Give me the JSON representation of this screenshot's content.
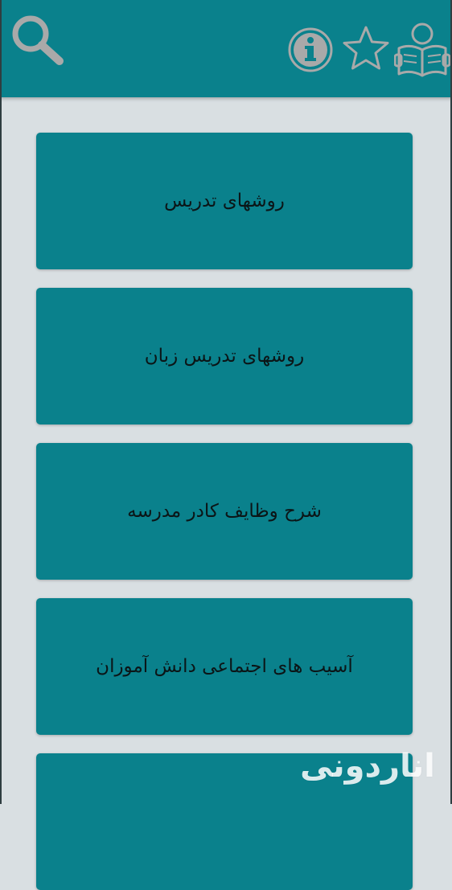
{
  "toolbar": {
    "icons": [
      "search-icon",
      "info-icon",
      "star-icon",
      "reading-book-icon"
    ]
  },
  "items": [
    {
      "label": "روشهای تدریس"
    },
    {
      "label": "روشهای تدریس زبان"
    },
    {
      "label": "شرح وظایف کادر مدرسه"
    },
    {
      "label": "آسیب های اجتماعی دانش آموزان"
    }
  ],
  "watermark": "اناردونی",
  "colors": {
    "primary": "#0a818c",
    "background": "#d9dfe2",
    "icon": "#a9a9a9",
    "text": "#0b1517"
  }
}
